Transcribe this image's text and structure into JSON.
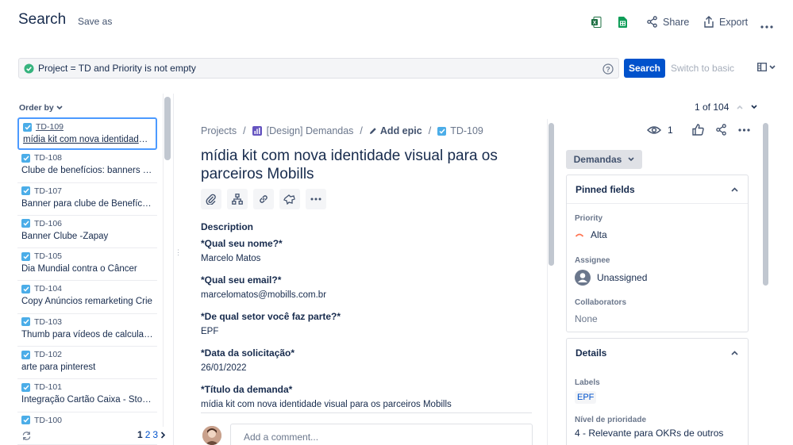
{
  "header": {
    "title": "Search",
    "save_as": "Save as",
    "share": "Share",
    "export": "Export"
  },
  "jql": {
    "query": "Project = TD and Priority is not empty",
    "search_label": "Search",
    "switch_label": "Switch to basic"
  },
  "list": {
    "order_by": "Order by",
    "items": [
      {
        "key": "TD-109",
        "summary": "mídia kit com nova identidade visual para os parceiros Mobills"
      },
      {
        "key": "TD-108",
        "summary": "Clube de benefícios: banners parceiros"
      },
      {
        "key": "TD-107",
        "summary": "Banner para clube de Benefícios"
      },
      {
        "key": "TD-106",
        "summary": "Banner Clube -Zapay"
      },
      {
        "key": "TD-105",
        "summary": "Dia Mundial contra o Câncer"
      },
      {
        "key": "TD-104",
        "summary": "Copy Anúncios remarketing Crie"
      },
      {
        "key": "TD-103",
        "summary": "Thumb para vídeos de calculadoras"
      },
      {
        "key": "TD-102",
        "summary": "arte para pinterest"
      },
      {
        "key": "TD-101",
        "summary": "Integração Cartão Caixa - Stories"
      },
      {
        "key": "TD-100",
        "summary": ""
      }
    ],
    "pages": [
      "1",
      "2",
      "3"
    ]
  },
  "detail": {
    "count": "1 of 104",
    "breadcrumb": {
      "projects": "Projects",
      "project": "[Design] Demandas",
      "add_epic": "Add epic",
      "key": "TD-109"
    },
    "title": "mídia kit com nova identidade visual para os parceiros Mobills",
    "description_heading": "Description",
    "qa": [
      {
        "q": "*Qual seu nome?*",
        "a": "Marcelo Matos"
      },
      {
        "q": "*Qual seu email?*",
        "a": "marcelomatos@mobills.com.br"
      },
      {
        "q": "*De qual setor você faz parte?*",
        "a": "EPF"
      },
      {
        "q": "*Data da solicitação*",
        "a": "26/01/2022"
      },
      {
        "q": "*Título da demanda*",
        "a": "mídia kit com nova identidade visual para os parceiros Mobills"
      }
    ],
    "comment_placeholder": "Add a comment..."
  },
  "side": {
    "watchers": "1",
    "status": "Demandas",
    "pinned_heading": "Pinned fields",
    "priority_label": "Priority",
    "priority_value": "Alta",
    "assignee_label": "Assignee",
    "assignee_value": "Unassigned",
    "collaborators_label": "Collaborators",
    "collaborators_value": "None",
    "details_heading": "Details",
    "labels_label": "Labels",
    "labels_value": "EPF",
    "nivel_label": "Nível de prioridade",
    "nivel_value": "4 - Relevante para OKRs de outros"
  },
  "colors": {
    "primary": "#0052cc",
    "checkbox": "#4bade8",
    "selected_border": "#4c9aff",
    "priority_alta": "#ff7452"
  }
}
